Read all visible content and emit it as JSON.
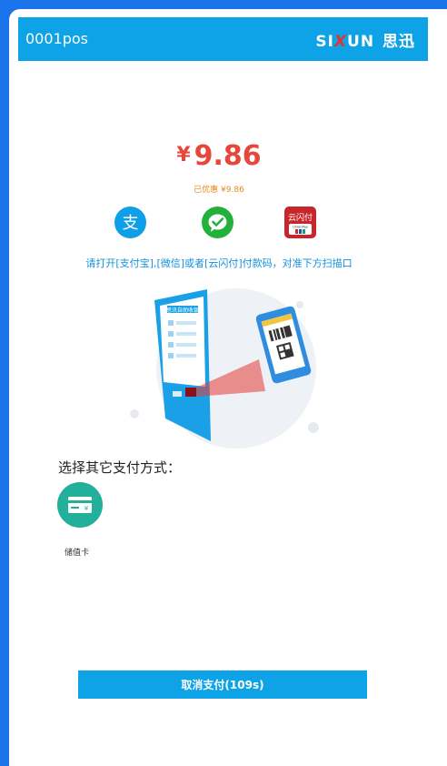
{
  "header": {
    "title": "0001pos",
    "brand_prefix": "SI",
    "brand_x": "X",
    "brand_suffix": "UN",
    "brand_cn": "思迅"
  },
  "payment": {
    "currency_symbol": "¥",
    "amount": "9.86",
    "discount": "已优惠 ¥9.86",
    "instruction": "请打开[支付宝],[微信]或者[云闪付]付款码，对准下方扫描口"
  },
  "methods": {
    "alipay_glyph": "支",
    "unionpay_text": "云闪付",
    "unionpay_sub": "UnionPay"
  },
  "illustration": {
    "kiosk_title": "思讯自助收银"
  },
  "other": {
    "label": "选择其它支付方式：",
    "stored_card": "储值卡"
  },
  "cancel": {
    "label": "取消支付(109s)"
  },
  "colors": {
    "accent": "#0ea2e7",
    "amount": "#e7473b",
    "discount": "#e68a1f",
    "background": "#1a73e8"
  }
}
